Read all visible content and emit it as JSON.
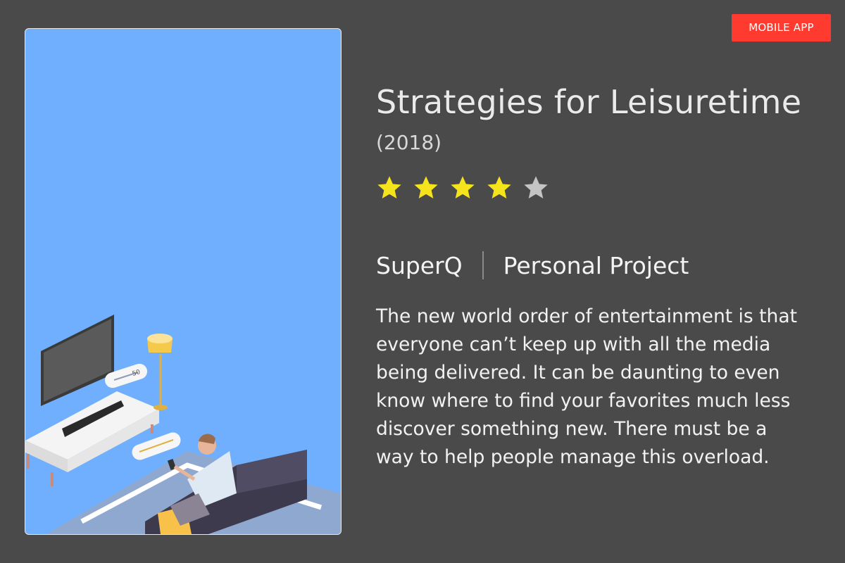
{
  "badge": {
    "label": "MOBILE APP",
    "color": "#ff3b30"
  },
  "illustration": {
    "volume_label": "50",
    "background_color": "#6faffd"
  },
  "project": {
    "title": "Strategies for Leisuretime",
    "year": "(2018)",
    "rating": {
      "value": 4,
      "max": 5
    },
    "client": "SuperQ",
    "type": "Personal Project",
    "description": "The new world order of entertainment is that everyone can’t keep up with all the media being delivered. It can be daunting to even know where to find your favorites much less discover something new. There must be a way to help people manage this overload."
  },
  "colors": {
    "background": "#4a4a4a",
    "star_filled": "#f5e31c",
    "star_empty": "#c4c4c4"
  }
}
